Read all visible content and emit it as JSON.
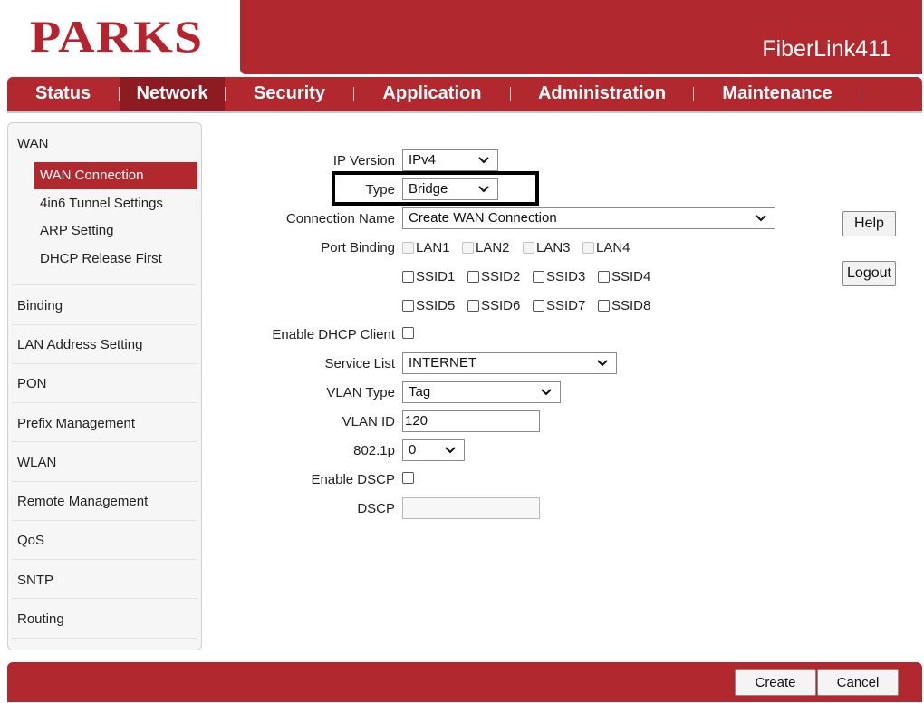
{
  "header": {
    "logo_text": "PARKS",
    "model": "FiberLink411"
  },
  "colors": {
    "brand_red": "#b1292f",
    "active_tab": "#8c1c22"
  },
  "nav": {
    "tabs": [
      {
        "label": "Status"
      },
      {
        "label": "Network",
        "active": true
      },
      {
        "label": "Security"
      },
      {
        "label": "Application"
      },
      {
        "label": "Administration"
      },
      {
        "label": "Maintenance"
      }
    ]
  },
  "sidebar": {
    "wan": "WAN",
    "wan_items": [
      {
        "label": "WAN Connection",
        "active": true
      },
      {
        "label": "4in6 Tunnel Settings"
      },
      {
        "label": "ARP Setting"
      },
      {
        "label": "DHCP Release First"
      }
    ],
    "groups": [
      {
        "label": "Binding"
      },
      {
        "label": "LAN Address Setting"
      },
      {
        "label": "PON"
      },
      {
        "label": "Prefix Management"
      },
      {
        "label": "WLAN"
      },
      {
        "label": "Remote Management"
      },
      {
        "label": "QoS"
      },
      {
        "label": "SNTP"
      },
      {
        "label": "Routing"
      }
    ]
  },
  "form": {
    "ip_version": {
      "label": "IP Version",
      "value": "IPv4"
    },
    "type": {
      "label": "Type",
      "value": "Bridge"
    },
    "connection_name": {
      "label": "Connection Name",
      "value": "Create WAN Connection"
    },
    "port_binding": {
      "label": "Port Binding",
      "lan": [
        "LAN1",
        "LAN2",
        "LAN3",
        "LAN4"
      ],
      "ssid_row1": [
        "SSID1",
        "SSID2",
        "SSID3",
        "SSID4"
      ],
      "ssid_row2": [
        "SSID5",
        "SSID6",
        "SSID7",
        "SSID8"
      ]
    },
    "enable_dhcp_client": {
      "label": "Enable DHCP Client",
      "checked": false
    },
    "service_list": {
      "label": "Service List",
      "value": "INTERNET"
    },
    "vlan_type": {
      "label": "VLAN Type",
      "value": "Tag"
    },
    "vlan_id": {
      "label": "VLAN ID",
      "value": "120"
    },
    "dot1p": {
      "label": "802.1p",
      "value": "0"
    },
    "enable_dscp": {
      "label": "Enable DSCP",
      "checked": false
    },
    "dscp": {
      "label": "DSCP",
      "value": ""
    }
  },
  "buttons": {
    "help": "Help",
    "logout": "Logout",
    "create": "Create",
    "cancel": "Cancel"
  }
}
